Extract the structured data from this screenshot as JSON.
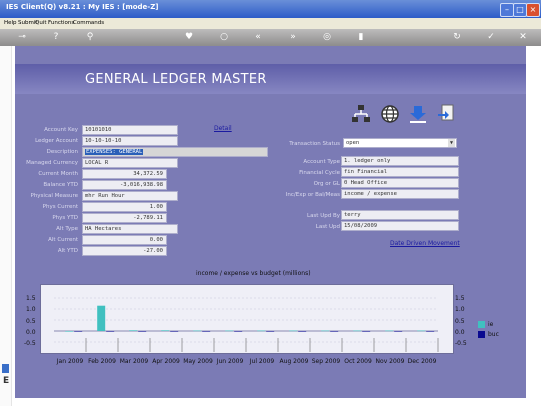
{
  "window": {
    "title": "IES Client(Q) v8.21 : My IES :    [mode-Z]"
  },
  "menu": [
    "Help",
    "Submit",
    "Quit",
    "Functions",
    "Commands"
  ],
  "page_title": "GENERAL LEDGER MASTER",
  "links": {
    "detail": "Detail",
    "date_driven": "Date Driven Movement"
  },
  "left_fields": [
    {
      "label": "Account Key",
      "value": "10101010"
    },
    {
      "label": "Ledger Account",
      "value": "10-10-10-10"
    },
    {
      "label": "Description",
      "value": "EXPENSES: GENERAL"
    },
    {
      "label": "Managed Currency",
      "value": "LOCAL R"
    },
    {
      "label": "Current Month",
      "value": "34,372.59"
    },
    {
      "label": "Balance YTD",
      "value": "-3,016,938.98"
    },
    {
      "label": "Physical Measure",
      "value": "mhr Run Hour"
    },
    {
      "label": "Phys Current",
      "value": "1.00"
    },
    {
      "label": "Phys YTD",
      "value": "-2,789.11"
    },
    {
      "label": "Alt Type",
      "value": "HA Hectares"
    },
    {
      "label": "Alt Current",
      "value": "0.00"
    },
    {
      "label": "Alt YTD",
      "value": "-27.00"
    }
  ],
  "right_fields": [
    {
      "label": "Transaction Status",
      "value": "open"
    },
    {
      "label": "Account Type",
      "value": "1. ledger only"
    },
    {
      "label": "Financial Cycle",
      "value": "fin Financial"
    },
    {
      "label": "Org or GL",
      "value": "0 Head Office"
    },
    {
      "label": "Inc/Exp or Bal/Meas",
      "value": "income / expense"
    },
    {
      "label": "Last Upd By",
      "value": "terry"
    },
    {
      "label": "Last Upd",
      "value": "15/08/2009"
    }
  ],
  "chart_data": {
    "type": "bar",
    "title": "income / expense vs budget (millions)",
    "categories": [
      "Jan 2009",
      "Feb 2009",
      "Mar 2009",
      "Apr 2009",
      "May 2009",
      "Jun 2009",
      "Jul 2009",
      "Aug 2009",
      "Sep 2009",
      "Oct 2009",
      "Nov 2009",
      "Dec 2009"
    ],
    "series": [
      {
        "name": "ie",
        "values": [
          0,
          1.15,
          0.03,
          0.03,
          0.02,
          0.02,
          0.02,
          0.02,
          0.02,
          0.02,
          0.02,
          0.02
        ]
      },
      {
        "name": "buc",
        "values": [
          0,
          0,
          0,
          0,
          0,
          0,
          0,
          0,
          0,
          0,
          0,
          0
        ]
      }
    ],
    "y_ticks": [
      "1.5",
      "1.0",
      "0.5",
      "0.0",
      "-0.5"
    ],
    "ylim": [
      -0.5,
      1.5
    ],
    "grid": true,
    "legend": "right",
    "colors": {
      "ie": "#40c0c0",
      "buc": "#0a0a90"
    }
  }
}
